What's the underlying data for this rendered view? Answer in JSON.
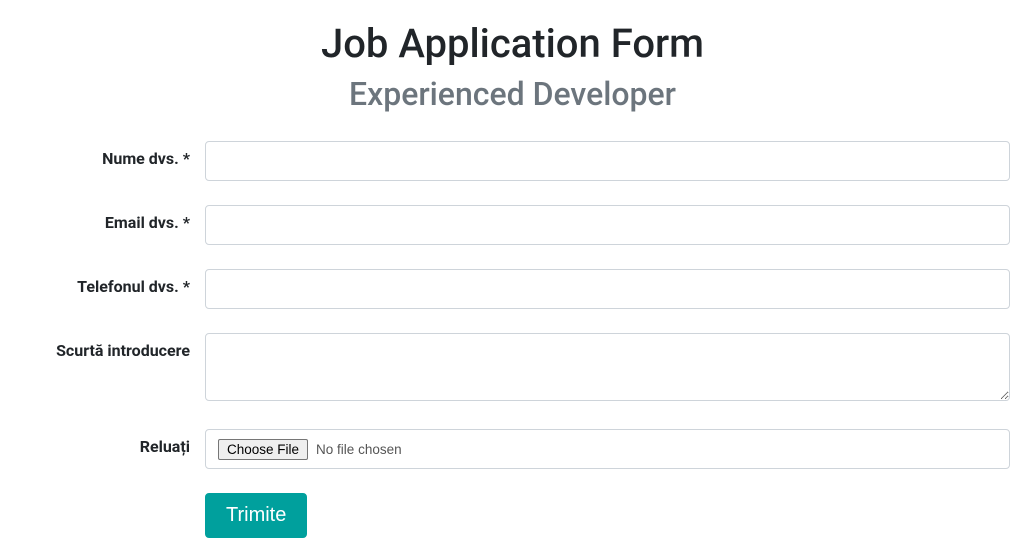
{
  "header": {
    "title": "Job Application Form",
    "subtitle": "Experienced Developer"
  },
  "form": {
    "fields": {
      "name": {
        "label": "Nume dvs. *",
        "value": ""
      },
      "email": {
        "label": "Email dvs. *",
        "value": ""
      },
      "phone": {
        "label": "Telefonul dvs. *",
        "value": ""
      },
      "intro": {
        "label": "Scurtă introducere",
        "value": ""
      },
      "resume": {
        "label": "Reluați",
        "button": "Choose File",
        "status": "No file chosen"
      }
    },
    "submit_label": "Trimite"
  }
}
